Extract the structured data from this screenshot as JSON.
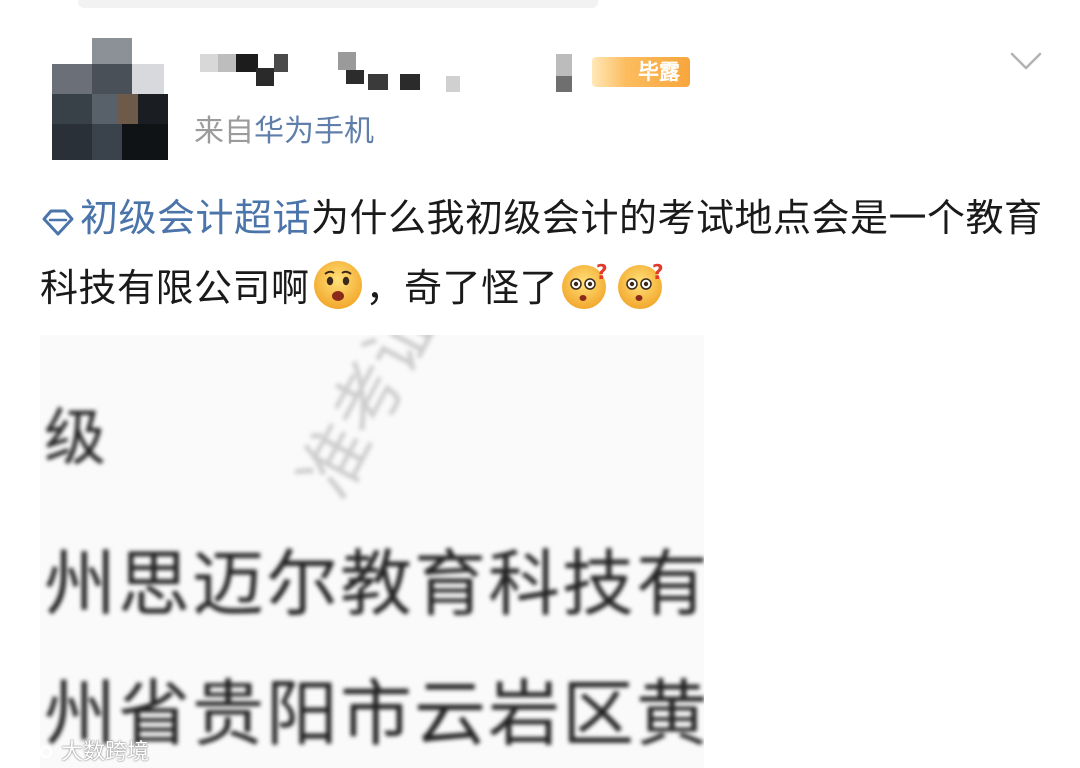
{
  "post": {
    "badge_text": "毕露",
    "source_prefix": "来自",
    "source_device": "华为手机",
    "topic": "初级会计超话",
    "text_part1": "为什么我初级会计的考试地点会是一个教育科技有限公司啊",
    "text_part2": "，奇了怪了",
    "emoji_sad": "frowning-face",
    "emoji_confused": "thinking-question-face"
  },
  "attached_image": {
    "line1": "级",
    "line2": "州思迈尔教育科技有",
    "line3": "州省贵阳市云岩区黄",
    "diagonal_watermark": "准考证·格考"
  },
  "image_watermark": "大数跨境",
  "colors": {
    "topic_blue": "#4a74aa",
    "source_gray": "#9b9b9b",
    "badge_orange": "#f7a63c"
  }
}
